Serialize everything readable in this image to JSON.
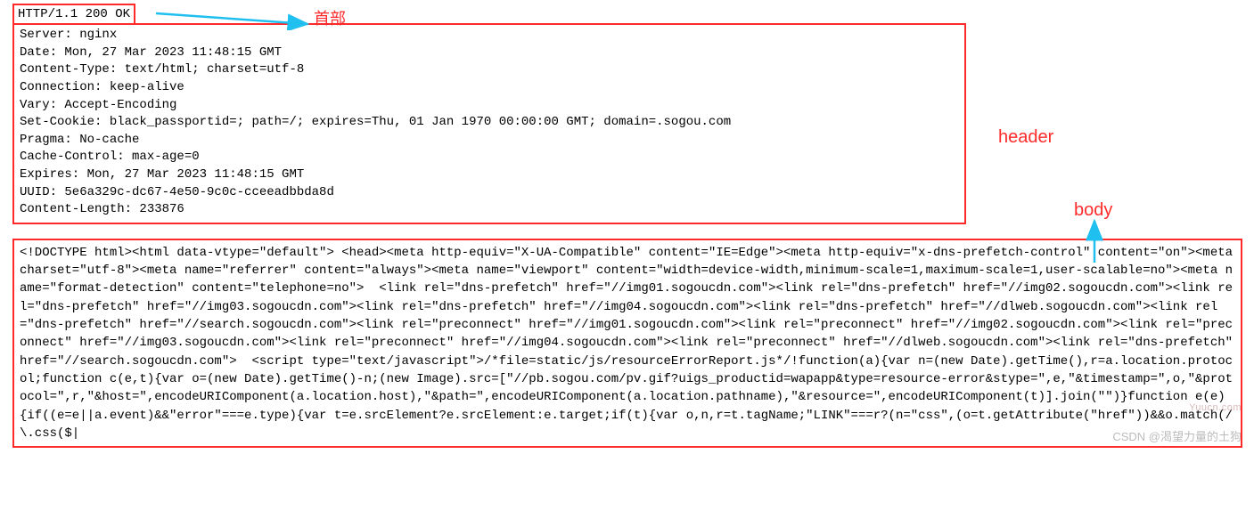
{
  "annotations": {
    "shoubu": "首部",
    "header": "header",
    "body": "body"
  },
  "status_line": "HTTP/1.1 200 OK",
  "headers_raw": "Server: nginx\nDate: Mon, 27 Mar 2023 11:48:15 GMT\nContent-Type: text/html; charset=utf-8\nConnection: keep-alive\nVary: Accept-Encoding\nSet-Cookie: black_passportid=; path=/; expires=Thu, 01 Jan 1970 00:00:00 GMT; domain=.sogou.com\nPragma: No-cache\nCache-Control: max-age=0\nExpires: Mon, 27 Mar 2023 11:48:15 GMT\nUUID: 5e6a329c-dc67-4e50-9c0c-cceeadbbda8d\nContent-Length: 233876",
  "body_raw": "<!DOCTYPE html><html data-vtype=\"default\"> <head><meta http-equiv=\"X-UA-Compatible\" content=\"IE=Edge\"><meta http-equiv=\"x-dns-prefetch-control\" content=\"on\"><meta charset=\"utf-8\"><meta name=\"referrer\" content=\"always\"><meta name=\"viewport\" content=\"width=device-width,minimum-scale=1,maximum-scale=1,user-scalable=no\"><meta name=\"format-detection\" content=\"telephone=no\">  <link rel=\"dns-prefetch\" href=\"//img01.sogoucdn.com\"><link rel=\"dns-prefetch\" href=\"//img02.sogoucdn.com\"><link rel=\"dns-prefetch\" href=\"//img03.sogoucdn.com\"><link rel=\"dns-prefetch\" href=\"//img04.sogoucdn.com\"><link rel=\"dns-prefetch\" href=\"//dlweb.sogoucdn.com\"><link rel=\"dns-prefetch\" href=\"//search.sogoucdn.com\"><link rel=\"preconnect\" href=\"//img01.sogoucdn.com\"><link rel=\"preconnect\" href=\"//img02.sogoucdn.com\"><link rel=\"preconnect\" href=\"//img03.sogoucdn.com\"><link rel=\"preconnect\" href=\"//img04.sogoucdn.com\"><link rel=\"preconnect\" href=\"//dlweb.sogoucdn.com\"><link rel=\"dns-prefetch\" href=\"//search.sogoucdn.com\">  <script type=\"text/javascript\">/*file=static/js/resourceErrorReport.js*/!function(a){var n=(new Date).getTime(),r=a.location.protocol;function c(e,t){var o=(new Date).getTime()-n;(new Image).src=[\"//pb.sogou.com/pv.gif?uigs_productid=wapapp&type=resource-error&stype=\",e,\"&timestamp=\",o,\"&protocol=\",r,\"&host=\",encodeURIComponent(a.location.host),\"&path=\",encodeURIComponent(a.location.pathname),\"&resource=\",encodeURIComponent(t)].join(\"\")}function e(e){if((e=e||a.event)&&\"error\"===e.type){var t=e.srcElement?e.srcElement:e.target;if(t){var o,n,r=t.tagName;\"LINK\"===r?(n=\"css\",(o=t.getAttribute(\"href\"))&&o.match(/\\.css($|",
  "watermark": "CSDN @渴望力量的土狗",
  "wm_small": "Yuucn.com"
}
